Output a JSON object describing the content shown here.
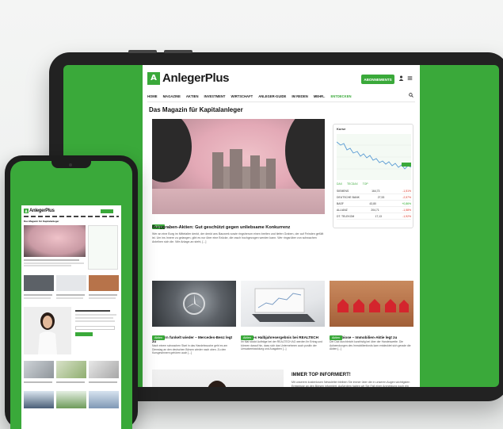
{
  "tablet": {
    "brand": {
      "logo_glyph": "A",
      "name": "AnlegerPlus"
    },
    "subscribe_label": "ABONNEMENTS",
    "header_icons": [
      "user-icon",
      "menu-icon"
    ],
    "nav": {
      "items": [
        "HOME",
        "MAGAZINE",
        "AKTIEN",
        "INVESTMENT",
        "WIRTSCHAFT",
        "ANLEGER-GUIDE",
        "IM REDEN",
        "MEHR..",
        "ENTDECKEN"
      ],
      "search_icon": "search-icon"
    },
    "section_title": "Das Magazin für Kapitalanleger",
    "hero": {
      "tag": "Aktien",
      "date": "",
      "title": "Burggraben-Aktien: Gut geschützt gegen unliebsame Konkurrenz",
      "excerpt": "Wer an eine Burg im Mittelalter denkt, der denkt ans Bauwerk sowie ringsherum einen breiten und tiefen Graben, der auf Feinden gefüllt ist. Um ins Innere zu gelangen, gibt es nur über eine Brücke, die rasch hochgezogen werden kann. Wer ringsrüber von schwachen Anleihen sich die. Wie Anlage-an steht, [...]"
    },
    "widget": {
      "label": "Kurse",
      "tabs": [
        "DAX",
        "TECDAX",
        "TOP"
      ],
      "rows": [
        {
          "name": "SIEMENS",
          "value": "164,73",
          "change": "-1,51%"
        },
        {
          "name": "DEUTSCHE BANK",
          "value": "27,53",
          "change": "-2,57%"
        },
        {
          "name": "BASF",
          "value": "43,80",
          "change": "+0,86%"
        },
        {
          "name": "ALLIANZ",
          "value": "204,71",
          "change": "-1,58%"
        },
        {
          "name": "DT. TELEKOM",
          "value": "17,13",
          "change": "-1,92%"
        }
      ]
    },
    "cards": [
      {
        "tag": "Aktien",
        "date": "",
        "title": "Der Stern funkelt wieder – Mercedes-Benz legt zu",
        "excerpt": "Nach einem schwachen Start in das Handelswoche geht es am Dienstag an den deutschen Börsen wieder nach oben. Zu den Kursgewinnern gehören auch [...]"
      },
      {
        "tag": "Aktien",
        "date": "",
        "title": "Positives Halbjahresergebnis bei REALTECH",
        "excerpt": "Im Mai stockt Aufträge bei der REALTECH AG werden Ihr Ertrag und können darauf hin, dass sich das Unternehmen auch positiv der Umsatzentwicklung und Ausgaben [...]"
      },
      {
        "tag": "Aktien",
        "date": "",
        "title": "Das dubiose – Immobilien-Aktie legt zu",
        "excerpt": "Der Dax durchbricht kurzfristig bei über der Handelsweite. Die Aufwendungen des Immobilienfonds kam entdecktet sich gerade die Aktien [...]"
      }
    ],
    "promo": {
      "title": "IMMER TOP INFORMIERT!",
      "text": "Mit unserem kostenlosen Newsletter bleiben Sie immer über die in unseren Augen wichtigsten Ereignisse an den Börsen informiert. Außerdem haben wir Sie Fall einer Anmeldung noch ein Sonderangebot für Sie parat. Melden Sie sich jetzt an! [...]"
    }
  },
  "phone": {
    "brand": {
      "logo_glyph": "A",
      "name": "AnlegerPlus"
    },
    "section_title": "Das Magazin für Kapitalanleger"
  },
  "colors": {
    "brand_green": "#3aa93a",
    "device_frame": "#222222",
    "background": "#f2f3f2"
  }
}
